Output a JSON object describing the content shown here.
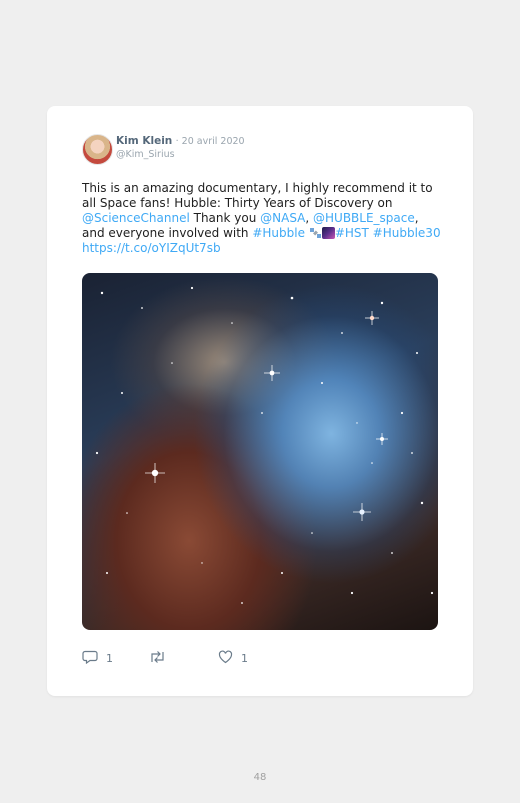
{
  "tweet": {
    "author_name": "Kim Klein",
    "date": "· 20 avril 2020",
    "handle": "@Kim_Sirius",
    "text_part1": "This is an amazing documentary, I highly recommend it to all Space fans! Hubble: Thirty Years of Discovery on ",
    "mention_science": "@ScienceChannel",
    "text_part2": " Thank you ",
    "mention_nasa": "@NASA",
    "comma": ", ",
    "mention_hubble_space": "@HUBBLE_space",
    "text_part3": ", and everyone involved with ",
    "hashtag_hubble": "#Hubble",
    "hashtag_hst": "#HST",
    "hashtag_hubble30": "#Hubble30",
    "short_link": "https://t.co/oYIZqUt7sb",
    "reply_count": "1",
    "like_count": "1",
    "accent_color": "#3fa9f5"
  },
  "icons": {
    "reply": "reply-icon",
    "retweet": "retweet-icon",
    "like": "heart-icon",
    "satellite_emoji": "satellite-emoji-icon",
    "galaxy_emoji": "milky-way-emoji-icon"
  },
  "page": {
    "number": "48"
  }
}
